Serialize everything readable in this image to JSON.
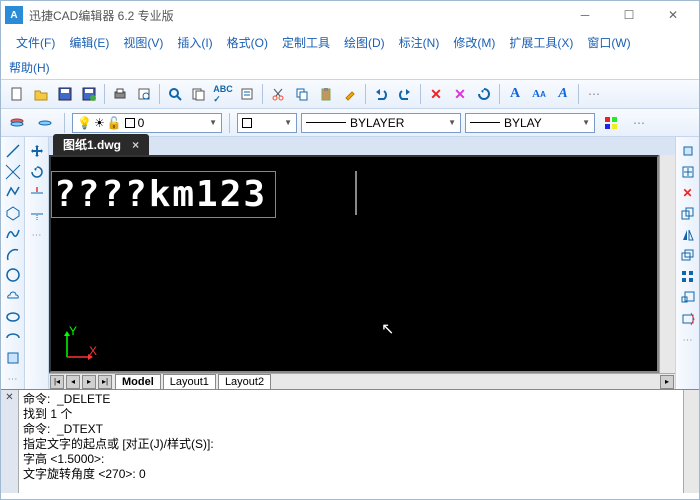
{
  "window": {
    "title": "迅捷CAD编辑器 6.2 专业版"
  },
  "menus": [
    "文件(F)",
    "编辑(E)",
    "视图(V)",
    "插入(I)",
    "格式(O)",
    "定制工具",
    "绘图(D)",
    "标注(N)",
    "修改(M)",
    "扩展工具(X)",
    "窗口(W)"
  ],
  "menus2": [
    "帮助(H)"
  ],
  "layer": {
    "name": "0"
  },
  "linetype": "BYLAYER",
  "lineweight": "BYLAY",
  "document": {
    "name": "图纸1.dwg"
  },
  "canvas_text": "????km123",
  "model_tabs": [
    "Model",
    "Layout1",
    "Layout2"
  ],
  "cmd": {
    "l1": "命令:  _DELETE",
    "l2": "找到 1 个",
    "l3": "命令:  _DTEXT",
    "l4": "指定文字的起点或 [对正(J)/样式(S)]:",
    "l5": "字高 <1.5000>:",
    "l6": "文字旋转角度 <270>: 0"
  }
}
